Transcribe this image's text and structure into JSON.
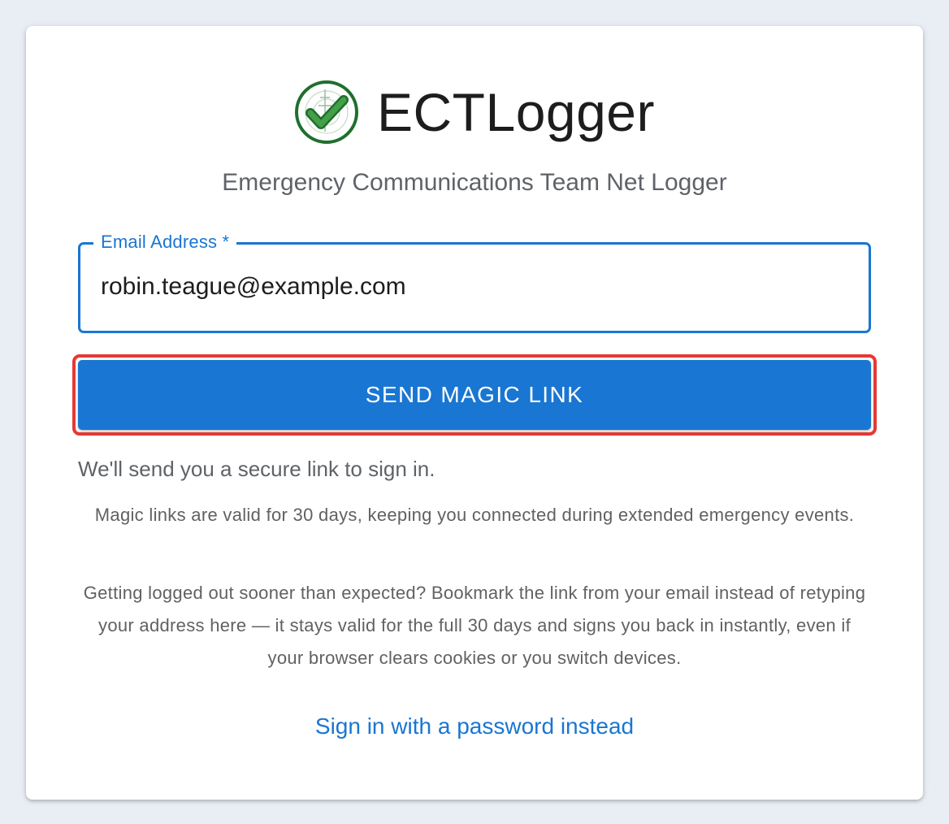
{
  "app": {
    "name": "ECTLogger",
    "subtitle": "Emergency Communications Team Net Logger",
    "logo_icon": "checkmark-radio-tower-icon"
  },
  "login_form": {
    "email_label": "Email Address *",
    "email_value": "robin.teague@example.com",
    "send_button_label": "SEND MAGIC LINK",
    "hint": "We'll send you a secure link to sign in.",
    "info_validity": "Magic links are valid for 30 days, keeping you connected during extended emergency events.",
    "info_bookmark": "Getting logged out sooner than expected? Bookmark the link from your email instead of retyping your address here — it stays valid for the full 30 days and signs you back in instantly, even if your browser clears cookies or you switch devices.",
    "password_link": "Sign in with a password instead"
  },
  "colors": {
    "background": "#e9edf4",
    "primary": "#1976d2",
    "highlight": "#e53935",
    "logo_green": "#2e8b3a"
  }
}
